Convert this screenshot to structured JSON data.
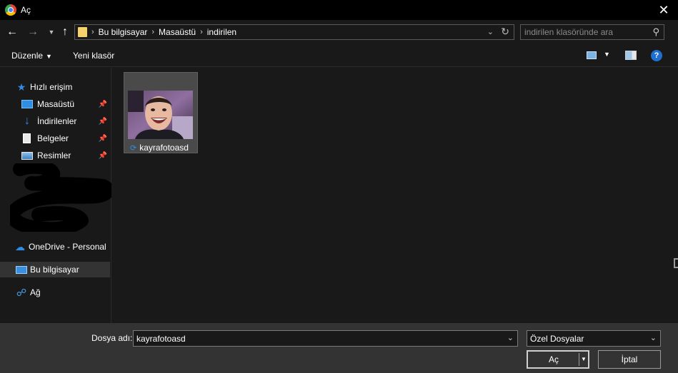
{
  "window": {
    "title": "Aç",
    "colors": {
      "background": "#191919",
      "titlebar": "#000000",
      "bottombar": "#333333",
      "accent": "#2f8de4"
    }
  },
  "nav": {
    "back_icon": "arrow-left-icon",
    "forward_icon": "arrow-right-icon",
    "recent_icon": "chevron-down-icon",
    "up_icon": "arrow-up-icon",
    "breadcrumbs": [
      "Bu bilgisayar",
      "Masaüstü",
      "indirilen"
    ],
    "search_placeholder": "indirilen klasöründe ara"
  },
  "toolbar": {
    "organize_label": "Düzenle",
    "new_folder_label": "Yeni klasör"
  },
  "sidebar": {
    "quick_access": "Hızlı erişim",
    "items": [
      {
        "label": "Masaüstü",
        "icon": "desktop-icon",
        "pinned": true
      },
      {
        "label": "İndirilenler",
        "icon": "download-icon",
        "pinned": true
      },
      {
        "label": "Belgeler",
        "icon": "document-icon",
        "pinned": true
      },
      {
        "label": "Resimler",
        "icon": "pictures-icon",
        "pinned": true
      }
    ],
    "onedrive": "OneDrive - Personal",
    "this_pc": "Bu bilgisayar",
    "network": "Ağ"
  },
  "files": [
    {
      "name": "kayrafotoasd",
      "type": "image",
      "sync_icon": "sync-icon"
    }
  ],
  "footer": {
    "filename_label": "Dosya adı:",
    "filename_value": "kayrafotoasd",
    "filter_value": "Özel Dosyalar",
    "open_label": "Aç",
    "cancel_label": "İptal"
  }
}
